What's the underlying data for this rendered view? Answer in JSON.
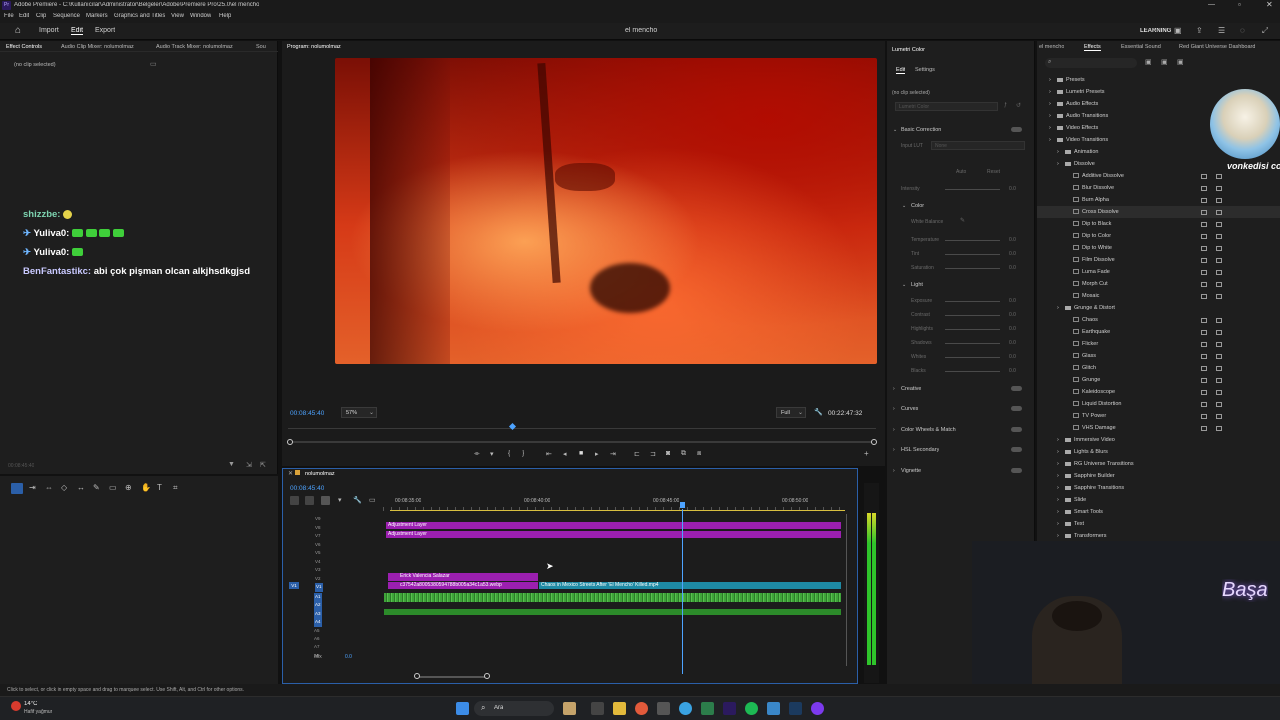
{
  "window": {
    "app_logo": "Pr",
    "title": "Adobe Premiere - C:\\Kullanıcılar\\Administrator\\Belgeler\\Adobe\\Premiere Pro\\25.0\\el mencho"
  },
  "menu": [
    "File",
    "Edit",
    "Clip",
    "Sequence",
    "Markers",
    "Graphics and Titles",
    "View",
    "Window",
    "Help"
  ],
  "header": {
    "tabs": [
      "Import",
      "Edit",
      "Export"
    ],
    "project_name": "el mencho",
    "workspace": "LEARNING"
  },
  "left_panel": {
    "tabs": [
      "Effect Controls",
      "Audio Clip Mixer: nolumolmaz",
      "Audio Track Mixer: nolumolmaz",
      "Sou"
    ],
    "no_clip": "(no clip selected)",
    "time": "00:08:45:40"
  },
  "chat": [
    {
      "user": "shizzbe:",
      "message": "",
      "user_color": "#7dd3b0",
      "emotes": 1
    },
    {
      "user": "Yuliva0:",
      "message": "",
      "user_color": "#ffffff",
      "emotes": 4
    },
    {
      "user": "Yuliva0:",
      "message": "",
      "user_color": "#ffffff",
      "emotes": 1
    },
    {
      "user": "BenFantastikc:",
      "message": "abi çok pişman olcan alkjhsdkgjsd",
      "user_color": "#c9c9ff",
      "emotes": 0
    }
  ],
  "program": {
    "tab": "Program: nolumolmaz",
    "current_time": "00:08:45:40",
    "zoom": "57%",
    "quality": "Full",
    "duration": "00:22:47:32"
  },
  "timeline": {
    "sequence_name": "nolumolmaz",
    "current_time": "00:08:45:40",
    "ruler_labels": [
      "00:08:35:00",
      "00:08:40:00",
      "00:08:45:00",
      "00:08:50:00"
    ],
    "video_tracks": [
      "V9",
      "V8",
      "V7",
      "V6",
      "V5",
      "V4",
      "V3",
      "V2",
      "V1"
    ],
    "audio_tracks": [
      "A1",
      "A2",
      "A3",
      "A4",
      "A5",
      "A6",
      "A7",
      "A8"
    ],
    "mix_label": "Mix",
    "mix_value": "0.0",
    "clips": {
      "adj1": "Adjustment Layer",
      "adj2": "Adjustment Layer",
      "erick": "Erick Valencia Salazar",
      "webp": "c37542a8005380594788b005a34c1a53.webp",
      "main": "Chaos in Mexico Streets After 'El Mencho' Killed.mp4"
    }
  },
  "lumetri": {
    "title": "Lumetri Color",
    "tabs": [
      "Edit",
      "Settings"
    ],
    "no_clip": "(no clip selected)",
    "effect_dropdown": "Lumetri Color",
    "sections": {
      "basic": "Basic Correction",
      "input_lut": "Input LUT",
      "input_lut_value": "None",
      "auto": "Auto",
      "reset": "Reset",
      "intensity": "Intensity",
      "color": "Color",
      "white_balance": "White Balance",
      "temperature": "Temperature",
      "tint": "Tint",
      "saturation": "Saturation",
      "light": "Light",
      "exposure": "Exposure",
      "contrast": "Contrast",
      "highlights": "Highlights",
      "shadows": "Shadows",
      "whites": "Whites",
      "blacks": "Blacks",
      "creative": "Creative",
      "curves": "Curves",
      "color_wheels": "Color Wheels & Match",
      "hsl": "HSL Secondary",
      "vignette": "Vignette"
    },
    "zero": "0.0"
  },
  "effects": {
    "tabs": [
      "el mencho",
      "Effects",
      "Essential Sound",
      "Red Giant Universe Dashboard"
    ],
    "tree": [
      {
        "label": "Presets",
        "level": 0,
        "type": "folder"
      },
      {
        "label": "Lumetri Presets",
        "level": 0,
        "type": "folder"
      },
      {
        "label": "Audio Effects",
        "level": 0,
        "type": "folder"
      },
      {
        "label": "Audio Transitions",
        "level": 0,
        "type": "folder"
      },
      {
        "label": "Video Effects",
        "level": 0,
        "type": "folder"
      },
      {
        "label": "Video Transitions",
        "level": 0,
        "type": "folder"
      },
      {
        "label": "Animation",
        "level": 1,
        "type": "folder"
      },
      {
        "label": "Dissolve",
        "level": 1,
        "type": "folder"
      },
      {
        "label": "Additive Dissolve",
        "level": 2,
        "type": "fx"
      },
      {
        "label": "Blur Dissolve",
        "level": 2,
        "type": "fx"
      },
      {
        "label": "Burn Alpha",
        "level": 2,
        "type": "fx"
      },
      {
        "label": "Cross Dissolve",
        "level": 2,
        "type": "fx",
        "selected": true
      },
      {
        "label": "Dip to Black",
        "level": 2,
        "type": "fx"
      },
      {
        "label": "Dip to Color",
        "level": 2,
        "type": "fx"
      },
      {
        "label": "Dip to White",
        "level": 2,
        "type": "fx"
      },
      {
        "label": "Film Dissolve",
        "level": 2,
        "type": "fx"
      },
      {
        "label": "Luma Fade",
        "level": 2,
        "type": "fx"
      },
      {
        "label": "Morph Cut",
        "level": 2,
        "type": "fx"
      },
      {
        "label": "Mosaic",
        "level": 2,
        "type": "fx"
      },
      {
        "label": "Grunge & Distort",
        "level": 1,
        "type": "folder"
      },
      {
        "label": "Chaos",
        "level": 2,
        "type": "fx"
      },
      {
        "label": "Earthquake",
        "level": 2,
        "type": "fx"
      },
      {
        "label": "Flicker",
        "level": 2,
        "type": "fx"
      },
      {
        "label": "Glass",
        "level": 2,
        "type": "fx"
      },
      {
        "label": "Glitch",
        "level": 2,
        "type": "fx"
      },
      {
        "label": "Grunge",
        "level": 2,
        "type": "fx"
      },
      {
        "label": "Kaleidoscope",
        "level": 2,
        "type": "fx"
      },
      {
        "label": "Liquid Distortion",
        "level": 2,
        "type": "fx"
      },
      {
        "label": "TV Power",
        "level": 2,
        "type": "fx"
      },
      {
        "label": "VHS Damage",
        "level": 2,
        "type": "fx"
      },
      {
        "label": "Immersive Video",
        "level": 1,
        "type": "folder"
      },
      {
        "label": "Lights & Blurs",
        "level": 1,
        "type": "folder"
      },
      {
        "label": "RG Universe Transitions",
        "level": 1,
        "type": "folder"
      },
      {
        "label": "Sapphire Builder",
        "level": 1,
        "type": "folder"
      },
      {
        "label": "Sapphire Transitions",
        "level": 1,
        "type": "folder"
      },
      {
        "label": "Slide",
        "level": 1,
        "type": "folder"
      },
      {
        "label": "Smart Tools",
        "level": 1,
        "type": "folder"
      },
      {
        "label": "Text",
        "level": 1,
        "type": "folder"
      },
      {
        "label": "Transformers",
        "level": 1,
        "type": "folder"
      }
    ]
  },
  "overlay": {
    "avatar_caption": "vonkedisi coin",
    "neon_sign": "Başa"
  },
  "status": {
    "hint": "Click to select, or click in empty space and drag to marquee select. Use Shift, Alt, and Ctrl for other options."
  },
  "taskbar": {
    "temperature": "14°C",
    "weather": "Hafif yağmur",
    "search_placeholder": "Ara"
  }
}
